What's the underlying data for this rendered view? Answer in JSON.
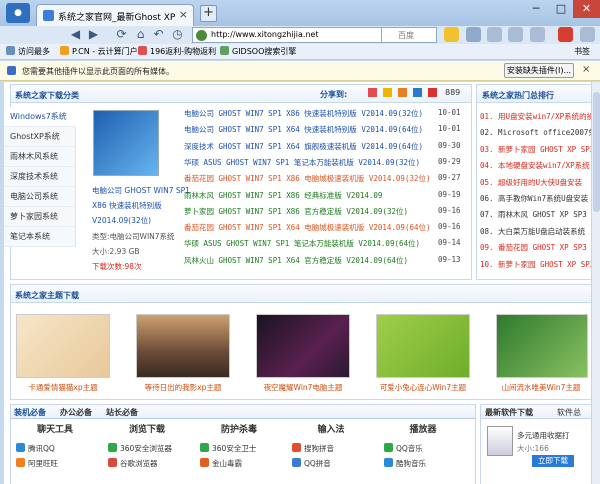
{
  "browser": {
    "tab_title": "系统之家官网_最新Ghost XP Sp3系统...",
    "url": "http://www.xitongzhijia.net",
    "search_placeholder": "百度",
    "bookmarks": [
      "访问最多",
      "P.CN - 云计算门户",
      "196返利-购物返利",
      "GIDSOO搜索引擎"
    ],
    "bookmark_right": "书签",
    "infobar_msg": "您需要其他插件以显示此页面的所有媒体。",
    "infobar_btn": "安装缺失插件(I)..."
  },
  "download": {
    "title": "系统之家下载分类",
    "share": "分享到:",
    "share_count": "889",
    "nav": [
      "Windows7系统",
      "GhostXP系统",
      "雨林木风系统",
      "深度技术系统",
      "电脑公司系统",
      "萝卜家园系统",
      "笔记本系统"
    ],
    "feature": {
      "title1": "电脑公司 GHOST WIN7 SP1",
      "title2": "X86 快速装机特别版",
      "title3": "V2014.09(32位)",
      "type": "类型:电脑公司WIN7系统",
      "size": "大小:2.93 GB",
      "count": "下载次数:98次"
    },
    "items": [
      {
        "text": "电脑公司 GHOST WIN7 SP1 X86 快速装机特别版 V2014.09(32位)",
        "date": "10-01",
        "color": "#1a4fb0"
      },
      {
        "text": "电脑公司 GHOST WIN7 SP1 X64 快速装机特别版 V2014.09(64位)",
        "date": "10-01",
        "color": "#1a4fb0"
      },
      {
        "text": "深度技术 GHOST WIN7 SP1 X64 旗舰极速装机版 V2014.09(64位)",
        "date": "09-30",
        "color": "#1a4fb0"
      },
      {
        "text": "华硕 ASUS GHOST WIN7 SP1 笔记本万能装机版 V2014.09(32位)",
        "date": "09-29",
        "color": "#1a4fb0"
      },
      {
        "text": "番茄花园 GHOST WIN7 SP1 X86 电脑城极速装机版 V2014.09(32位)",
        "date": "09-27",
        "color": "#d9531e"
      },
      {
        "text": "雨林木风 GHOST WIN7 SP1 X86 经典标准版 V2014.09",
        "date": "09-19",
        "color": "#1d7a1d"
      },
      {
        "text": "萝卜家园 GHOST WIN7 SP1 X86 官方稳定版 V2014.09(32位)",
        "date": "09-16",
        "color": "#1d7a1d"
      },
      {
        "text": "番茄花园 GHOST WIN7 SP1 X64 电脑城极速装机版 V2014.09(64位)",
        "date": "09-16",
        "color": "#d9531e"
      },
      {
        "text": "华硕 ASUS GHOST WIN7 SP1 笔记本万能装机版 V2014.09(64位)",
        "date": "09-14",
        "color": "#1d7a1d"
      },
      {
        "text": "风林火山 GHOST WIN7 SP1 X64 官方稳定版 V2014.09(64位)",
        "date": "09-13",
        "color": "#1d7a1d"
      }
    ]
  },
  "ranking": {
    "title": "系统之家热门总排行",
    "items": [
      {
        "text": "01. 用U盘安装win7/XP系统的操",
        "color": "#d9261c"
      },
      {
        "text": "02. Microsoft office2007免",
        "color": "#333"
      },
      {
        "text": "03. 新萝卜家园 GHOST XP SP3",
        "color": "#d9261c"
      },
      {
        "text": "04. 本地硬盘安装win7/XP系统",
        "color": "#d9261c"
      },
      {
        "text": "05. 超级好用的U大侠U盘安装",
        "color": "#d9261c"
      },
      {
        "text": "06. 高手教你Win7系统U盘安装",
        "color": "#333"
      },
      {
        "text": "07. 雨林木风 GHOST XP SP3 系",
        "color": "#333"
      },
      {
        "text": "08. 大白菜万能U盘启动装系统",
        "color": "#333"
      },
      {
        "text": "09. 番茄花园 GHOST XP SP3 装",
        "color": "#d9261c"
      },
      {
        "text": "10. 新萝卜家园 GHOST XP SP3",
        "color": "#d9261c"
      }
    ]
  },
  "themes": {
    "title": "系统之家主题下载",
    "items": [
      "卡通爱情猫猫xp主题",
      "等待日出的我影xp主题",
      "夜空魔耀Win7电脑主题",
      "可爱小兔心连心Win7主题",
      "山间流水唯美Win7主题"
    ]
  },
  "bottom": {
    "tabs": [
      "装机必备",
      "办公必备",
      "站长必备"
    ],
    "categories": [
      "聊天工具",
      "浏览下载",
      "防护杀毒",
      "输入法",
      "播放器"
    ],
    "softs": [
      [
        "腾讯QQ",
        "阿里旺旺"
      ],
      [
        "360安全浏览器",
        "谷歌浏览器"
      ],
      [
        "360安全卫士",
        "金山毒霸"
      ],
      [
        "搜狗拼音",
        "QQ拼音"
      ],
      [
        "QQ音乐",
        "酷狗音乐"
      ]
    ],
    "latest_tab": "最新软件下载",
    "latest_tab2": "软件总",
    "latest_name": "多元通用收据打",
    "latest_size": "大小:166",
    "latest_btn": "立即下载"
  }
}
